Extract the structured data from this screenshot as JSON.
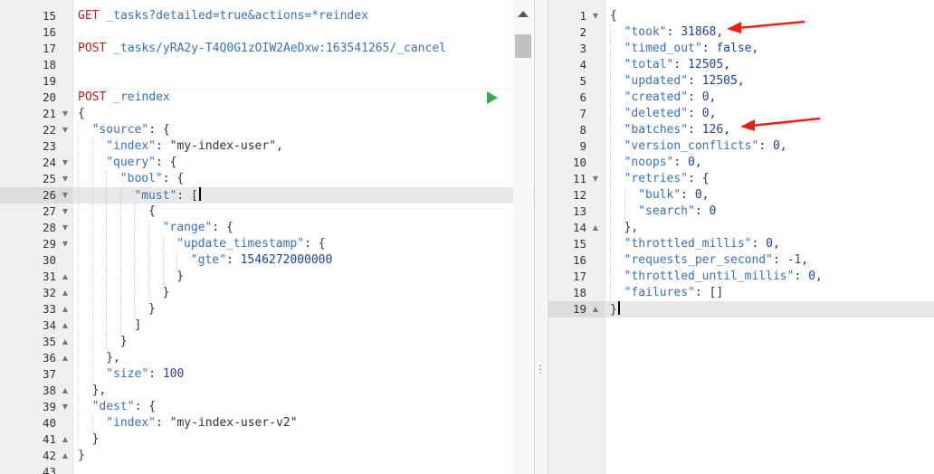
{
  "request_editor": {
    "lines": [
      {
        "n": "15",
        "fold": "",
        "active": false,
        "indent": 0,
        "tokens": [
          [
            "m",
            "GET "
          ],
          [
            "u",
            "_tasks?detailed=true&actions=*reindex"
          ]
        ]
      },
      {
        "n": "16",
        "fold": "",
        "active": false,
        "indent": 0,
        "tokens": []
      },
      {
        "n": "17",
        "fold": "",
        "active": false,
        "indent": 0,
        "tokens": [
          [
            "m",
            "POST "
          ],
          [
            "u",
            "_tasks/yRA2y-T4Q0G1zOIW2AeDxw:163541265/_cancel"
          ]
        ]
      },
      {
        "n": "18",
        "fold": "",
        "active": false,
        "indent": 0,
        "tokens": []
      },
      {
        "n": "19",
        "fold": "",
        "active": false,
        "indent": 0,
        "tokens": []
      },
      {
        "n": "20",
        "fold": "",
        "active": false,
        "indent": 0,
        "tokens": [
          [
            "m",
            "POST "
          ],
          [
            "u",
            "_reindex"
          ]
        ]
      },
      {
        "n": "21",
        "fold": "▼",
        "active": false,
        "indent": 0,
        "tokens": [
          [
            "p",
            "{"
          ]
        ]
      },
      {
        "n": "22",
        "fold": "▼",
        "active": false,
        "indent": 1,
        "tokens": [
          [
            "k",
            "\"source\""
          ],
          [
            "p",
            ": {"
          ]
        ]
      },
      {
        "n": "23",
        "fold": "",
        "active": false,
        "indent": 2,
        "tokens": [
          [
            "k",
            "\"index\""
          ],
          [
            "p",
            ": "
          ],
          [
            "s",
            "\"my-index-user\""
          ],
          [
            "p",
            ","
          ]
        ]
      },
      {
        "n": "24",
        "fold": "▼",
        "active": false,
        "indent": 2,
        "tokens": [
          [
            "k",
            "\"query\""
          ],
          [
            "p",
            ": {"
          ]
        ]
      },
      {
        "n": "25",
        "fold": "▼",
        "active": false,
        "indent": 3,
        "tokens": [
          [
            "k",
            "\"bool\""
          ],
          [
            "p",
            ": {"
          ]
        ]
      },
      {
        "n": "26",
        "fold": "▼",
        "active": true,
        "indent": 4,
        "tokens": [
          [
            "k",
            "\"must\""
          ],
          [
            "p",
            ": ["
          ]
        ],
        "cursor": true
      },
      {
        "n": "27",
        "fold": "▼",
        "active": false,
        "indent": 5,
        "tokens": [
          [
            "p",
            "{"
          ]
        ]
      },
      {
        "n": "28",
        "fold": "▼",
        "active": false,
        "indent": 6,
        "tokens": [
          [
            "k",
            "\"range\""
          ],
          [
            "p",
            ": {"
          ]
        ]
      },
      {
        "n": "29",
        "fold": "▼",
        "active": false,
        "indent": 7,
        "tokens": [
          [
            "k",
            "\"update_timestamp\""
          ],
          [
            "p",
            ": {"
          ]
        ]
      },
      {
        "n": "30",
        "fold": "",
        "active": false,
        "indent": 8,
        "tokens": [
          [
            "k",
            "\"gte\""
          ],
          [
            "p",
            ": "
          ],
          [
            "n",
            "1546272000000"
          ]
        ]
      },
      {
        "n": "31",
        "fold": "▲",
        "active": false,
        "indent": 7,
        "tokens": [
          [
            "p",
            "}"
          ]
        ]
      },
      {
        "n": "32",
        "fold": "▲",
        "active": false,
        "indent": 6,
        "tokens": [
          [
            "p",
            "}"
          ]
        ]
      },
      {
        "n": "33",
        "fold": "▲",
        "active": false,
        "indent": 5,
        "tokens": [
          [
            "p",
            "}"
          ]
        ]
      },
      {
        "n": "34",
        "fold": "▲",
        "active": false,
        "indent": 4,
        "tokens": [
          [
            "p",
            "]"
          ]
        ]
      },
      {
        "n": "35",
        "fold": "▲",
        "active": false,
        "indent": 3,
        "tokens": [
          [
            "p",
            "}"
          ]
        ]
      },
      {
        "n": "36",
        "fold": "▲",
        "active": false,
        "indent": 2,
        "tokens": [
          [
            "p",
            "},"
          ]
        ]
      },
      {
        "n": "37",
        "fold": "",
        "active": false,
        "indent": 2,
        "tokens": [
          [
            "k",
            "\"size\""
          ],
          [
            "p",
            ": "
          ],
          [
            "n",
            "100"
          ]
        ]
      },
      {
        "n": "38",
        "fold": "▲",
        "active": false,
        "indent": 1,
        "tokens": [
          [
            "p",
            "},"
          ]
        ]
      },
      {
        "n": "39",
        "fold": "▼",
        "active": false,
        "indent": 1,
        "tokens": [
          [
            "k",
            "\"dest\""
          ],
          [
            "p",
            ": {"
          ]
        ]
      },
      {
        "n": "40",
        "fold": "",
        "active": false,
        "indent": 2,
        "tokens": [
          [
            "k",
            "\"index\""
          ],
          [
            "p",
            ": "
          ],
          [
            "s",
            "\"my-index-user-v2\""
          ]
        ]
      },
      {
        "n": "41",
        "fold": "▲",
        "active": false,
        "indent": 1,
        "tokens": [
          [
            "p",
            "}"
          ]
        ]
      },
      {
        "n": "42",
        "fold": "▲",
        "active": false,
        "indent": 0,
        "tokens": [
          [
            "p",
            "}"
          ]
        ]
      },
      {
        "n": "43",
        "fold": "",
        "active": false,
        "indent": 0,
        "tokens": []
      }
    ]
  },
  "response_viewer": {
    "lines": [
      {
        "n": "1",
        "fold": "▼",
        "active": false,
        "indent": 0,
        "tokens": [
          [
            "p",
            "{"
          ]
        ]
      },
      {
        "n": "2",
        "fold": "",
        "active": false,
        "indent": 1,
        "tokens": [
          [
            "k",
            "\"took\""
          ],
          [
            "p",
            ": "
          ],
          [
            "n",
            "31868"
          ],
          [
            "p",
            ","
          ]
        ],
        "arrow": true
      },
      {
        "n": "3",
        "fold": "",
        "active": false,
        "indent": 1,
        "tokens": [
          [
            "k",
            "\"timed_out\""
          ],
          [
            "p",
            ": "
          ],
          [
            "kw",
            "false"
          ],
          [
            "p",
            ","
          ]
        ]
      },
      {
        "n": "4",
        "fold": "",
        "active": false,
        "indent": 1,
        "tokens": [
          [
            "k",
            "\"total\""
          ],
          [
            "p",
            ": "
          ],
          [
            "n",
            "12505"
          ],
          [
            "p",
            ","
          ]
        ]
      },
      {
        "n": "5",
        "fold": "",
        "active": false,
        "indent": 1,
        "tokens": [
          [
            "k",
            "\"updated\""
          ],
          [
            "p",
            ": "
          ],
          [
            "n",
            "12505"
          ],
          [
            "p",
            ","
          ]
        ]
      },
      {
        "n": "6",
        "fold": "",
        "active": false,
        "indent": 1,
        "tokens": [
          [
            "k",
            "\"created\""
          ],
          [
            "p",
            ": "
          ],
          [
            "n",
            "0"
          ],
          [
            "p",
            ","
          ]
        ]
      },
      {
        "n": "7",
        "fold": "",
        "active": false,
        "indent": 1,
        "tokens": [
          [
            "k",
            "\"deleted\""
          ],
          [
            "p",
            ": "
          ],
          [
            "n",
            "0"
          ],
          [
            "p",
            ","
          ]
        ]
      },
      {
        "n": "8",
        "fold": "",
        "active": false,
        "indent": 1,
        "tokens": [
          [
            "k",
            "\"batches\""
          ],
          [
            "p",
            ": "
          ],
          [
            "n",
            "126"
          ],
          [
            "p",
            ","
          ]
        ],
        "arrow": true
      },
      {
        "n": "9",
        "fold": "",
        "active": false,
        "indent": 1,
        "tokens": [
          [
            "k",
            "\"version_conflicts\""
          ],
          [
            "p",
            ": "
          ],
          [
            "n",
            "0"
          ],
          [
            "p",
            ","
          ]
        ]
      },
      {
        "n": "10",
        "fold": "",
        "active": false,
        "indent": 1,
        "tokens": [
          [
            "k",
            "\"noops\""
          ],
          [
            "p",
            ": "
          ],
          [
            "n",
            "0"
          ],
          [
            "p",
            ","
          ]
        ]
      },
      {
        "n": "11",
        "fold": "▼",
        "active": false,
        "indent": 1,
        "tokens": [
          [
            "k",
            "\"retries\""
          ],
          [
            "p",
            ": {"
          ]
        ]
      },
      {
        "n": "12",
        "fold": "",
        "active": false,
        "indent": 2,
        "tokens": [
          [
            "k",
            "\"bulk\""
          ],
          [
            "p",
            ": "
          ],
          [
            "n",
            "0"
          ],
          [
            "p",
            ","
          ]
        ]
      },
      {
        "n": "13",
        "fold": "",
        "active": false,
        "indent": 2,
        "tokens": [
          [
            "k",
            "\"search\""
          ],
          [
            "p",
            ": "
          ],
          [
            "n",
            "0"
          ]
        ]
      },
      {
        "n": "14",
        "fold": "▲",
        "active": false,
        "indent": 1,
        "tokens": [
          [
            "p",
            "},"
          ]
        ]
      },
      {
        "n": "15",
        "fold": "",
        "active": false,
        "indent": 1,
        "tokens": [
          [
            "k",
            "\"throttled_millis\""
          ],
          [
            "p",
            ": "
          ],
          [
            "n",
            "0"
          ],
          [
            "p",
            ","
          ]
        ]
      },
      {
        "n": "16",
        "fold": "",
        "active": false,
        "indent": 1,
        "tokens": [
          [
            "k",
            "\"requests_per_second\""
          ],
          [
            "p",
            ": "
          ],
          [
            "n",
            "-1"
          ],
          [
            "p",
            ","
          ]
        ]
      },
      {
        "n": "17",
        "fold": "",
        "active": false,
        "indent": 1,
        "tokens": [
          [
            "k",
            "\"throttled_until_millis\""
          ],
          [
            "p",
            ": "
          ],
          [
            "n",
            "0"
          ],
          [
            "p",
            ","
          ]
        ]
      },
      {
        "n": "18",
        "fold": "",
        "active": false,
        "indent": 1,
        "tokens": [
          [
            "k",
            "\"failures\""
          ],
          [
            "p",
            ": []"
          ]
        ]
      },
      {
        "n": "19",
        "fold": "▲",
        "active": true,
        "indent": 0,
        "tokens": [
          [
            "p",
            "}"
          ]
        ],
        "cursor": true
      }
    ]
  },
  "icons": {
    "run": "play-icon",
    "settings": "wrench-icon",
    "scroll": "scroll-up-icon",
    "splitter": "vertical-dots-icon"
  },
  "colors": {
    "key": "#3c6fb8",
    "number": "#1a3fb0",
    "method": "#c41a16",
    "run": "#3aa757",
    "arrow": "#e8231c"
  }
}
